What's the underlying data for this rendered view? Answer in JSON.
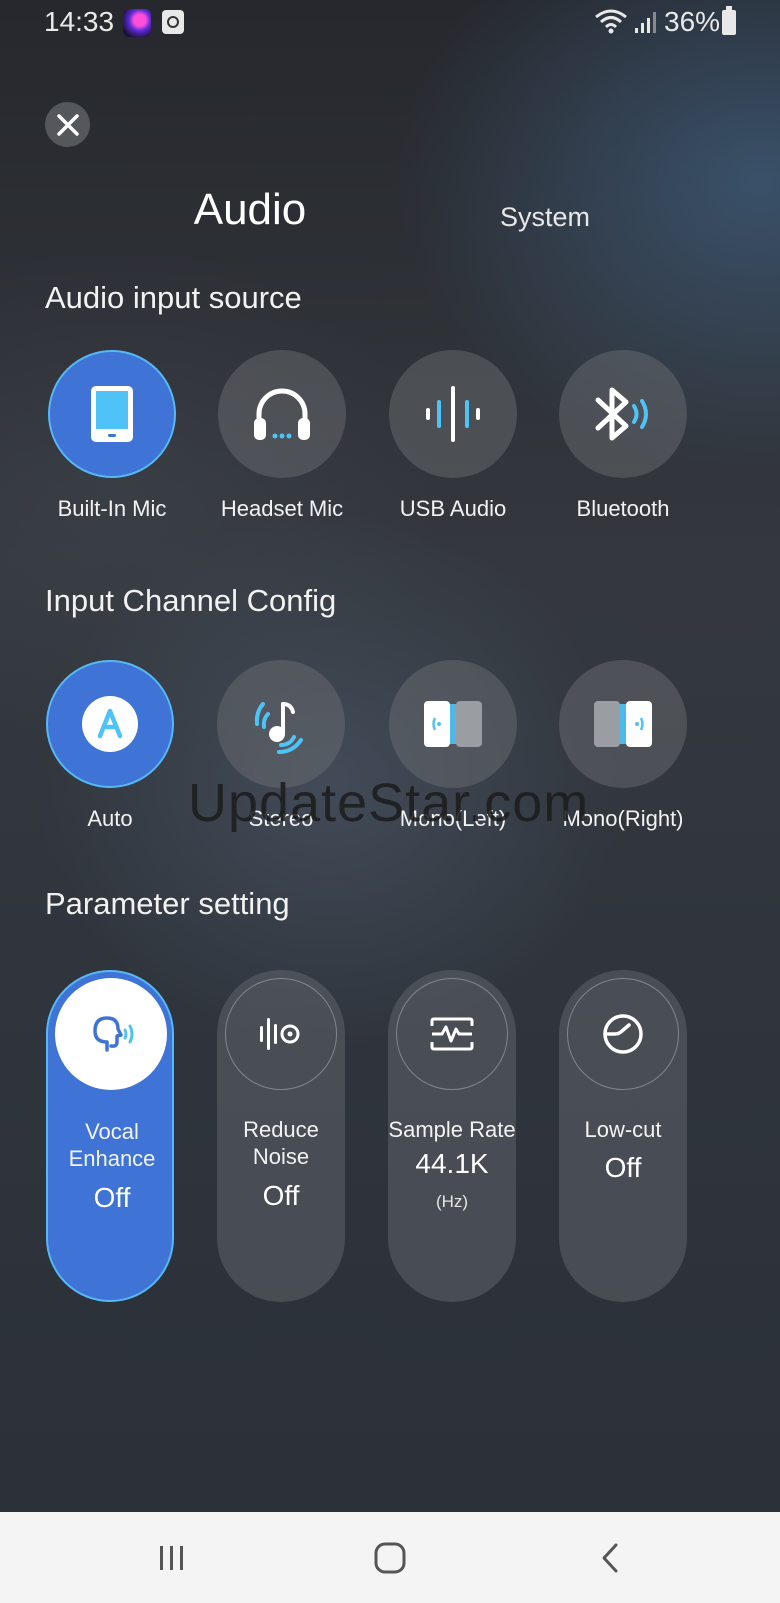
{
  "status_bar": {
    "time": "14:33",
    "battery": "36%"
  },
  "tabs": {
    "audio": "Audio",
    "system": "System"
  },
  "sections": {
    "input_source": "Audio input source",
    "channel_config": "Input Channel Config",
    "parameters": "Parameter setting"
  },
  "input_sources": [
    {
      "label": "Built-In Mic",
      "icon": "tablet-icon",
      "selected": true
    },
    {
      "label": "Headset Mic",
      "icon": "headset-icon",
      "selected": false
    },
    {
      "label": "USB Audio",
      "icon": "sound-wave-icon",
      "selected": false
    },
    {
      "label": "Bluetooth",
      "icon": "bluetooth-icon",
      "selected": false
    }
  ],
  "channel_configs": [
    {
      "label": "Auto",
      "icon": "auto-icon",
      "selected": true
    },
    {
      "label": "Stereo",
      "icon": "stereo-music-icon",
      "selected": false
    },
    {
      "label": "Mono(Left)",
      "icon": "mono-left-icon",
      "selected": false
    },
    {
      "label": "Mono(Right)",
      "icon": "mono-right-icon",
      "selected": false
    }
  ],
  "parameters": [
    {
      "label_line1": "Vocal",
      "label_line2": "Enhance",
      "value": "Off",
      "icon": "vocal-enhance-icon",
      "active": true
    },
    {
      "label_line1": "Reduce",
      "label_line2": "Noise",
      "value": "Off",
      "icon": "reduce-noise-icon",
      "active": false
    },
    {
      "label_line1": "Sample Rate",
      "value": "44.1K",
      "unit": "(Hz)",
      "icon": "sample-rate-icon",
      "active": false
    },
    {
      "label_line1": "Low-cut",
      "value": "Off",
      "icon": "low-cut-icon",
      "active": false
    }
  ],
  "watermark": "UpdateStar.com",
  "colors": {
    "accent_blue": "#3f74d6",
    "accent_cyan": "#4fc3f7",
    "ring": "#56b8f5"
  }
}
